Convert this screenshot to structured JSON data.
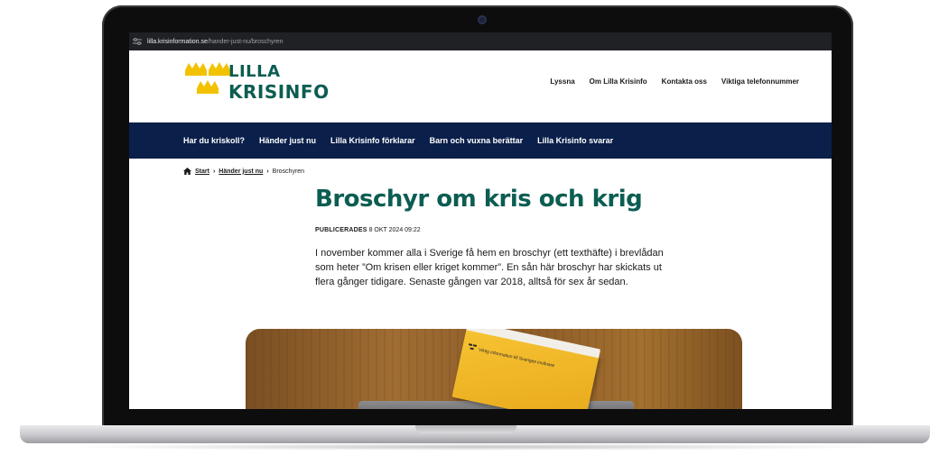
{
  "browser": {
    "url_domain": "lilla.krisinformation.se",
    "url_path": "/hander-just-nu/broschyren"
  },
  "logo": {
    "line1": "LILLA",
    "line2": "KRISINFO",
    "color": "#0c5d52",
    "crown_color": "#f2c200"
  },
  "top_links": [
    "Lyssna",
    "Om Lilla Krisinfo",
    "Kontakta oss",
    "Viktiga telefonnummer"
  ],
  "main_nav": [
    "Har du kriskoll?",
    "Händer just nu",
    "Lilla Krisinfo förklarar",
    "Barn och vuxna berättar",
    "Lilla Krisinfo svarar"
  ],
  "breadcrumb": {
    "home_icon": "home-icon",
    "start": "Start",
    "section": "Händer just nu",
    "current": "Broschyren"
  },
  "article": {
    "title": "Broschyr om kris och krig",
    "published_label": "PUBLICERADES",
    "published_date": "8 OKT 2024 09:22",
    "lead": "I november kommer alla i Sverige få hem en broschyr (ett texthäfte) i brevlådan som heter ”Om krisen eller kriget kommer”. En sån här broschyr har skickats ut flera gånger tidigare. Senaste gången var 2018, alltså för sex år sedan."
  },
  "photo": {
    "brochure_text": "Viktig information till Sveriges invånare"
  },
  "colors": {
    "nav_background": "#0a1f4a",
    "title_green": "#0c5d52"
  }
}
